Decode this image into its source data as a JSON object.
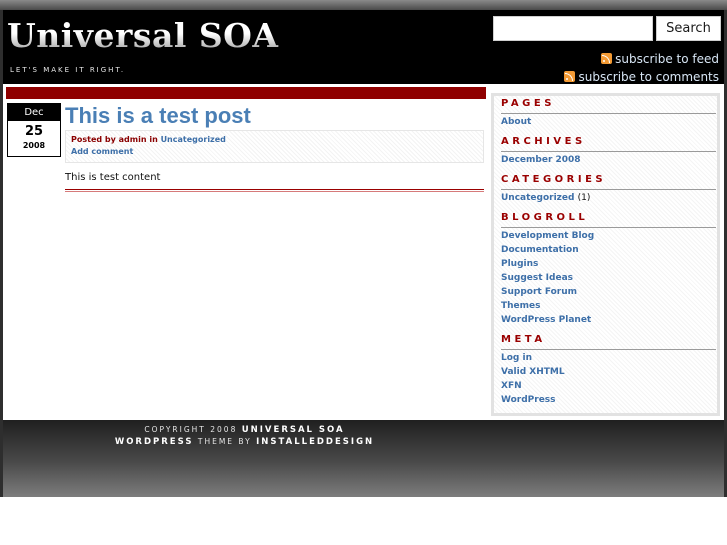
{
  "header": {
    "site_title": "Universal SOA",
    "tagline": "LET'S MAKE IT RIGHT.",
    "search_button": "Search",
    "search_value": "",
    "feed_link": "subscribe to feed",
    "comments_feed_link": "subscribe to comments",
    "rss_icon_color": "#f39a34"
  },
  "post": {
    "date": {
      "month": "Dec",
      "day": "25",
      "year": "2008"
    },
    "title": "This is a test post",
    "meta": {
      "prefix": "Posted by",
      "author": "admin",
      "in": "in",
      "category": "Uncategorized"
    },
    "add_comment": "Add comment",
    "body": "This is test content"
  },
  "sidebar": {
    "pages": {
      "heading": "PAGES",
      "items": [
        "About"
      ]
    },
    "archives": {
      "heading": "ARCHIVES",
      "items": [
        "December 2008"
      ]
    },
    "categories": {
      "heading": "CATEGORIES",
      "items": [
        {
          "label": "Uncategorized",
          "count": "(1)"
        }
      ]
    },
    "blogroll": {
      "heading": "BLOGROLL",
      "items": [
        "Development Blog",
        "Documentation",
        "Plugins",
        "Suggest Ideas",
        "Support Forum",
        "Themes",
        "WordPress Planet"
      ]
    },
    "meta": {
      "heading": "META",
      "items": [
        "Log in",
        "Valid XHTML",
        "XFN",
        "WordPress"
      ]
    }
  },
  "footer": {
    "copyright_prefix": "COPYRIGHT 2008",
    "copyright_name": "UNIVERSAL SOA",
    "theme_name": "WORDPRESS",
    "theme_by": "THEME BY",
    "designer": "INSTALLEDDESIGN"
  },
  "colors": {
    "accent_red": "#8f0000",
    "link_blue": "#3d6fa8",
    "title_blue": "#4a7fb5",
    "header_bg": "#000000"
  }
}
